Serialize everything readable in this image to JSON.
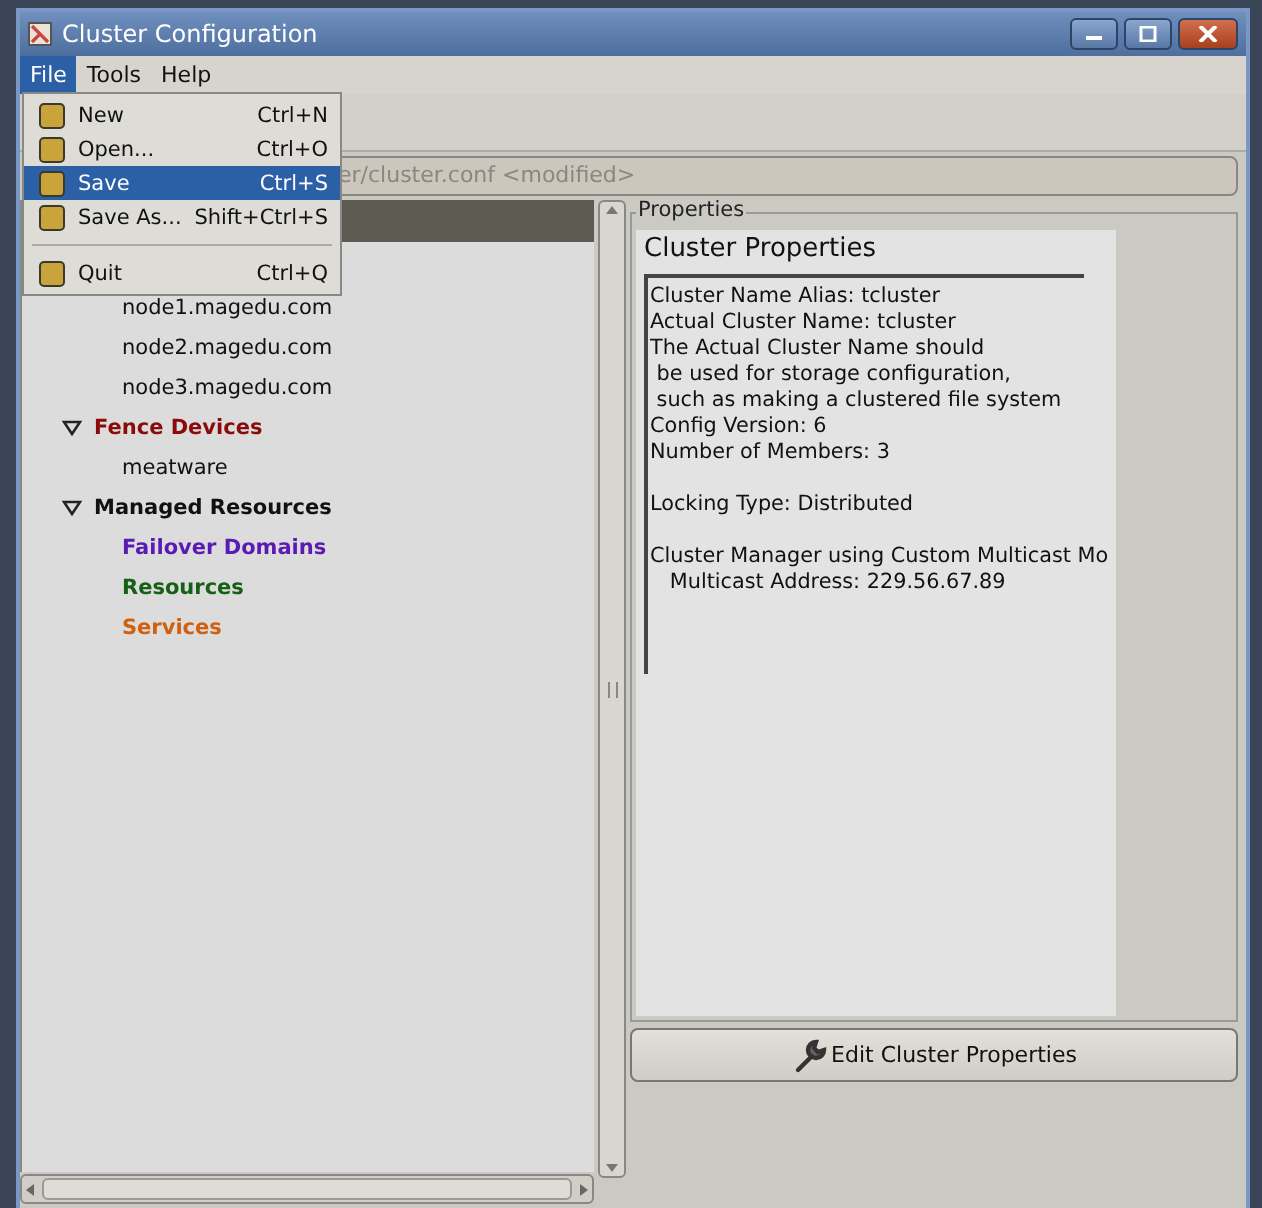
{
  "window": {
    "title": "Cluster Configuration"
  },
  "menu_bar": [
    {
      "label": "File",
      "selected": true
    },
    {
      "label": "Tools",
      "selected": false
    },
    {
      "label": "Help",
      "selected": false
    }
  ],
  "file_menu": [
    {
      "kind": "item",
      "label": "New",
      "shortcut": "Ctrl+N",
      "selected": false
    },
    {
      "kind": "item",
      "label": "Open...",
      "shortcut": "Ctrl+O",
      "selected": false
    },
    {
      "kind": "item",
      "label": "Save",
      "shortcut": "Ctrl+S",
      "selected": true
    },
    {
      "kind": "item",
      "label": "Save As...",
      "shortcut": "Shift+Ctrl+S",
      "selected": false
    },
    {
      "kind": "separator"
    },
    {
      "kind": "item",
      "label": "Quit",
      "shortcut": "Ctrl+Q",
      "selected": false
    }
  ],
  "path_field": {
    "value": "er/cluster.conf <modified>"
  },
  "tree": [
    {
      "children": [
        {
          "label": "node1.magedu.com"
        },
        {
          "label": "node2.magedu.com"
        },
        {
          "label": "node3.magedu.com"
        }
      ]
    },
    {
      "label": "Fence Devices",
      "color": "#8b0a0a",
      "expanded": true,
      "children": [
        {
          "label": "meatware",
          "color": "#111111"
        }
      ]
    },
    {
      "label": "Managed Resources",
      "color": "#111111",
      "expanded": true,
      "children": [
        {
          "label": "Failover Domains",
          "color": "#5a1ab4"
        },
        {
          "label": "Resources",
          "color": "#156015"
        },
        {
          "label": "Services",
          "color": "#d0600f"
        }
      ]
    }
  ],
  "properties": {
    "frame_label": "Properties",
    "heading": "Cluster Properties",
    "paragraphs": [
      [
        "Cluster Name Alias: tcluster",
        "Actual Cluster Name: tcluster",
        "The Actual Cluster Name should",
        " be used for storage configuration,",
        " such as making a clustered file system",
        "Config Version: 6",
        "Number of Members: 3"
      ],
      [
        "Locking Type: Distributed"
      ],
      [
        "Cluster Manager using Custom Multicast Mo",
        "   Multicast Address: 229.56.67.89"
      ]
    ]
  },
  "edit_button": {
    "label": "Edit Cluster Properties"
  }
}
